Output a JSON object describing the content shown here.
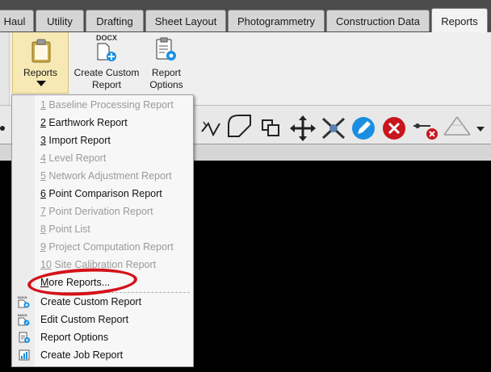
{
  "tabs": [
    {
      "label": "Haul",
      "active": false
    },
    {
      "label": "Utility",
      "active": false
    },
    {
      "label": "Drafting",
      "active": false
    },
    {
      "label": "Sheet Layout",
      "active": false
    },
    {
      "label": "Photogrammetry",
      "active": false
    },
    {
      "label": "Construction Data",
      "active": false
    },
    {
      "label": "Reports",
      "active": true
    }
  ],
  "ribbon": {
    "reports_label": "Reports",
    "create_custom_label": "Create Custom Report",
    "create_custom_badge": "DOCX",
    "report_options_label": "Report Options"
  },
  "menu": {
    "items": [
      {
        "num": "1",
        "text": " Baseline Processing Report",
        "enabled": false
      },
      {
        "num": "2",
        "text": " Earthwork Report",
        "enabled": true
      },
      {
        "num": "3",
        "text": " Import Report",
        "enabled": true
      },
      {
        "num": "4",
        "text": " Level Report",
        "enabled": false
      },
      {
        "num": "5",
        "text": " Network Adjustment Report",
        "enabled": false
      },
      {
        "num": "6",
        "text": " Point Comparison Report",
        "enabled": true
      },
      {
        "num": "7",
        "text": " Point Derivation Report",
        "enabled": false
      },
      {
        "num": "8",
        "text": " Point List",
        "enabled": false
      },
      {
        "num": "9",
        "text": " Project Computation Report",
        "enabled": false
      },
      {
        "num": "10",
        "text": " Site Calibration Report",
        "enabled": false
      },
      {
        "num": "M",
        "text": "ore Reports...",
        "enabled": true
      }
    ],
    "bottom_items": [
      {
        "label": "Create Custom Report",
        "icon": "docx-add-icon",
        "badge": "DOCX"
      },
      {
        "label": "Edit Custom Report",
        "icon": "docx-edit-icon",
        "badge": "DOCX"
      },
      {
        "label": "Report Options",
        "icon": "report-options-icon"
      },
      {
        "label": "Create Job Report",
        "icon": "job-report-icon"
      }
    ]
  },
  "toolbar_icons": [
    "polyline-icon",
    "fillet-icon",
    "overlap-icon",
    "move-icon",
    "explode-icon",
    "edit-pencil-icon",
    "delete-icon",
    "delete-node-icon",
    "baseline-icon",
    "more-dropdown-icon"
  ],
  "colors": {
    "accent_blue": "#1a8ee0",
    "danger_red": "#d4121a",
    "selected_ribbon": "#f6e9b3"
  }
}
